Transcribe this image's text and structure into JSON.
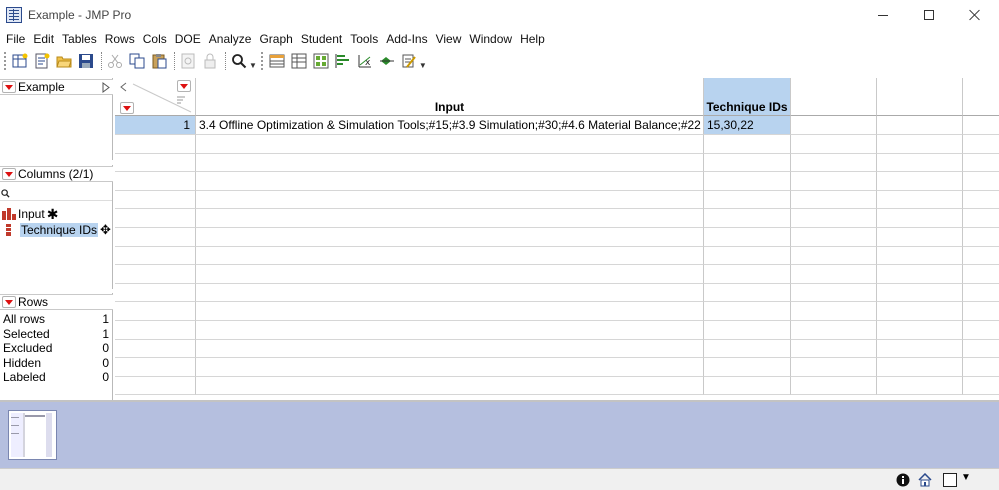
{
  "window": {
    "title": "Example - JMP Pro",
    "minimize_icon": "minimize-icon",
    "maximize_icon": "maximize-icon",
    "close_icon": "close-icon"
  },
  "menu": [
    "File",
    "Edit",
    "Tables",
    "Rows",
    "Cols",
    "DOE",
    "Analyze",
    "Graph",
    "Student",
    "Tools",
    "Add-Ins",
    "View",
    "Window",
    "Help"
  ],
  "toolbar": {
    "icons": [
      "new-data-table-icon",
      "new-script-icon",
      "open-icon",
      "save-icon",
      "cut-icon",
      "copy-icon",
      "paste-icon",
      "copy-with-headers-icon",
      "lock-icon",
      "search-icon",
      "data-table-view-icon",
      "tabulate-icon",
      "distribution-icon",
      "fit-y-by-x-icon",
      "fit-model-icon",
      "graph-builder-icon",
      "customize-icon"
    ]
  },
  "table_panel": {
    "title": "Example"
  },
  "columns_panel": {
    "title": "Columns (2/1)",
    "search_icon": "search-icon",
    "items": [
      {
        "name": "Input",
        "type_icon": "nominal-icon",
        "extra_icon": "formula-asterisk-icon",
        "selected": false
      },
      {
        "name": "Technique IDs",
        "type_icon": "ordinal-icon",
        "extra_icon": "move-cursor-icon",
        "selected": true
      }
    ]
  },
  "rows_panel": {
    "title": "Rows",
    "stats": [
      {
        "label": "All rows",
        "value": "1"
      },
      {
        "label": "Selected",
        "value": "1"
      },
      {
        "label": "Excluded",
        "value": "0"
      },
      {
        "label": "Hidden",
        "value": "0"
      },
      {
        "label": "Labeled",
        "value": "0"
      }
    ]
  },
  "grid": {
    "columns": [
      "Input",
      "Technique IDs"
    ],
    "rows": [
      {
        "row_num": "1",
        "cells": [
          "3.4 Offline Optimization & Simulation Tools;#15;#3.9 Simulation;#30;#4.6 Material Balance;#22",
          "15,30,22"
        ]
      }
    ]
  },
  "statusbar": {
    "icons": [
      "info-icon",
      "home-icon",
      "checkbox-icon",
      "dropdown-icon"
    ]
  },
  "colors": {
    "selection": "#b8d3ef",
    "red_triangle": "#d11111",
    "thumb_bg": "#b5bfdf"
  }
}
